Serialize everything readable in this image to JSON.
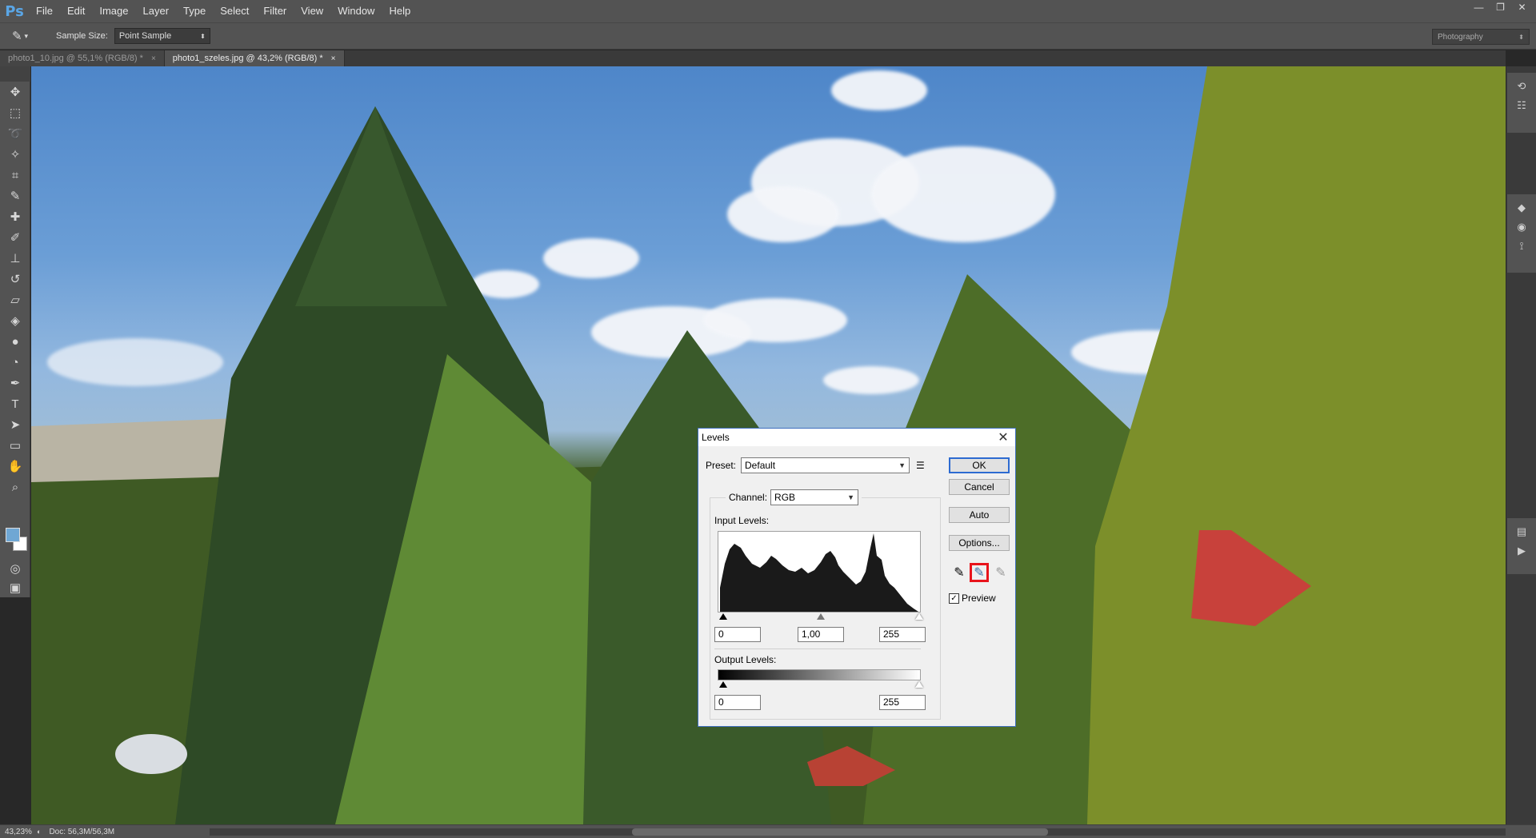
{
  "app": {
    "logo": "Ps"
  },
  "menu": [
    "File",
    "Edit",
    "Image",
    "Layer",
    "Type",
    "Select",
    "Filter",
    "View",
    "Window",
    "Help"
  ],
  "window_controls": {
    "minimize": "—",
    "restore": "❐",
    "close": "✕"
  },
  "options_bar": {
    "sample_size_label": "Sample Size:",
    "sample_size_value": "Point Sample",
    "workspace": "Photography"
  },
  "tabs": [
    {
      "label": "photo1_10.jpg @ 55,1% (RGB/8) *",
      "close": "×",
      "active": false
    },
    {
      "label": "photo1_szeles.jpg @ 43,2% (RGB/8) *",
      "close": "×",
      "active": true
    }
  ],
  "toolbar_icons": [
    "move-icon",
    "marquee-icon",
    "lasso-icon",
    "quick-select-icon",
    "crop-icon",
    "eyedropper-icon",
    "healing-brush-icon",
    "brush-icon",
    "clone-stamp-icon",
    "history-brush-icon",
    "eraser-icon",
    "paint-bucket-icon",
    "blur-icon",
    "dodge-icon",
    "pen-icon",
    "type-icon",
    "path-select-icon",
    "rectangle-icon",
    "hand-icon",
    "zoom-icon"
  ],
  "colors": {
    "foreground": "#6fa7d4",
    "background": "#ffffff",
    "dialog_border": "#3f6fbf",
    "highlight_red": "#e8141c"
  },
  "statusbar": {
    "zoom": "43,23%",
    "doc": "Doc: 56,3M/56,3M"
  },
  "levels_dialog": {
    "title": "Levels",
    "preset_label": "Preset:",
    "preset_value": "Default",
    "channel_label": "Channel:",
    "channel_value": "RGB",
    "input_levels_label": "Input Levels:",
    "input_black": "0",
    "input_gamma": "1,00",
    "input_white": "255",
    "output_levels_label": "Output Levels:",
    "output_black": "0",
    "output_white": "255",
    "buttons": {
      "ok": "OK",
      "cancel": "Cancel",
      "auto": "Auto",
      "options": "Options..."
    },
    "preview_label": "Preview",
    "preview_checked": true,
    "selected_eyedropper": "gray-point"
  }
}
